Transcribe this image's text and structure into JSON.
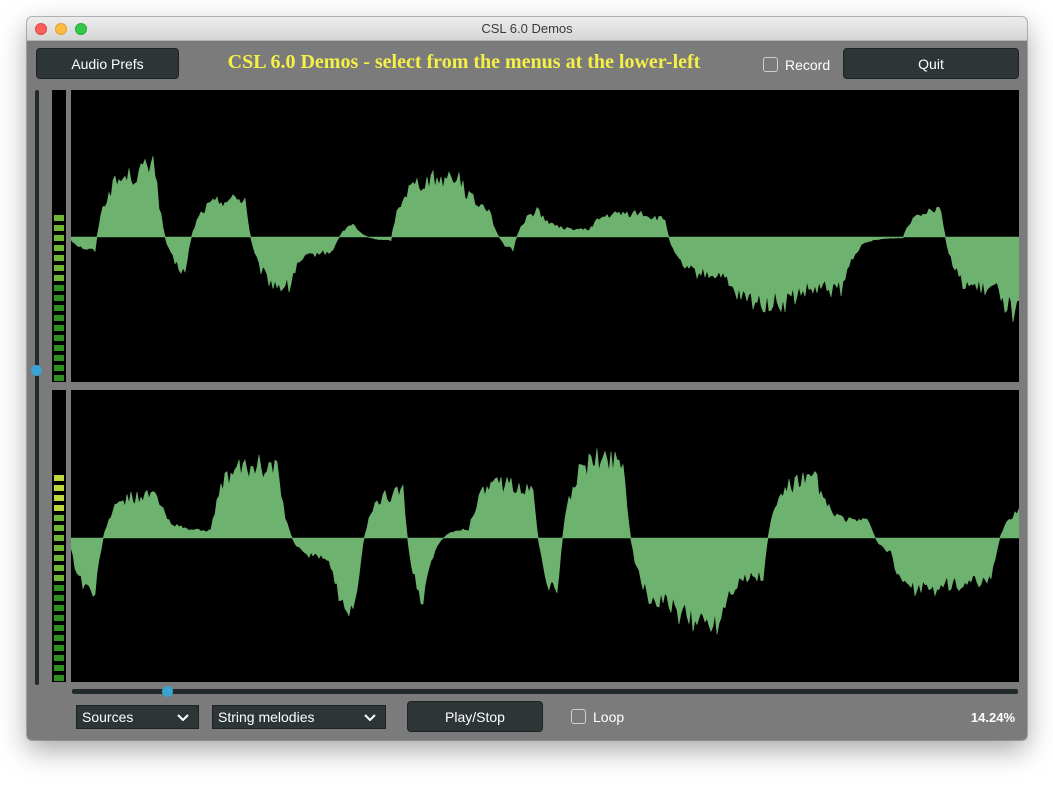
{
  "window": {
    "title": "CSL 6.0 Demos"
  },
  "header": {
    "audio_prefs_label": "Audio Prefs",
    "headline": "CSL 6.0 Demos - select from the menus at the lower-left",
    "record_label": "Record",
    "record_checked": false,
    "quit_label": "Quit"
  },
  "colors": {
    "background": "#7b7b7b",
    "button": "#2d3537",
    "headline": "#f5f046",
    "waveform": "#6db36f",
    "knob": "#3aa3cf"
  },
  "volume_slider": {
    "value": 0.53
  },
  "level_meters": [
    {
      "channel": "top",
      "level": 0.6
    },
    {
      "channel": "bottom",
      "level": 0.75
    }
  ],
  "position_slider": {
    "value": 0.1
  },
  "footer": {
    "source_category": "Sources",
    "demo": "String melodies",
    "play_stop_label": "Play/Stop",
    "loop_label": "Loop",
    "loop_checked": false,
    "progress_text": "14.24%"
  }
}
